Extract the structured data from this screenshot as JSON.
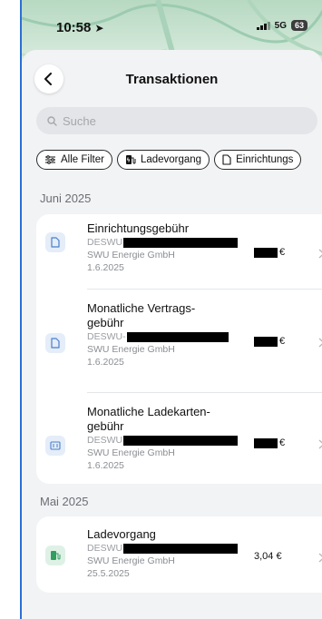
{
  "status": {
    "time": "10:58",
    "network": "5G",
    "battery": "63"
  },
  "header": {
    "title": "Transaktionen",
    "back_icon": "chevron-left-icon"
  },
  "search": {
    "placeholder": "Suche"
  },
  "filters": [
    {
      "label": "Alle Filter",
      "icon": "filter-sliders-icon"
    },
    {
      "label": "Ladevorgang",
      "icon": "charging-station-icon"
    },
    {
      "label": "Einrichtungs",
      "icon": "document-icon"
    }
  ],
  "sections": [
    {
      "title": "Juni 2025",
      "items": [
        {
          "title_lines": [
            "Einrichtungsgebühr"
          ],
          "ref_prefix": "DESWU",
          "company": "SWU Energie GmbH",
          "date": "1.6.2025",
          "amount": "€",
          "icon": "document-icon"
        },
        {
          "title_lines": [
            "Monatliche Vertrags-",
            "gebühr"
          ],
          "ref_prefix": "DESWU-",
          "company": "SWU Energie GmbH",
          "date": "1.6.2025",
          "amount": "€",
          "icon": "document-icon"
        },
        {
          "title_lines": [
            "Monatliche Ladekarten-",
            "gebühr"
          ],
          "ref_prefix": "DESWU",
          "company": "SWU Energie GmbH",
          "date": "1.6.2025",
          "amount": "€",
          "icon": "card-icon"
        }
      ]
    },
    {
      "title": "Mai 2025",
      "items": [
        {
          "title_lines": [
            "Ladevorgang"
          ],
          "ref_prefix": "DESWU",
          "company": "SWU Energie GmbH",
          "date": "25.5.2025",
          "amount": "3,04 €",
          "icon": "charging-station-icon"
        }
      ]
    }
  ],
  "colors": {
    "accent_blue": "#4a7fc9",
    "accent_green": "#2f9e5e",
    "background": "#f2f3f5"
  }
}
